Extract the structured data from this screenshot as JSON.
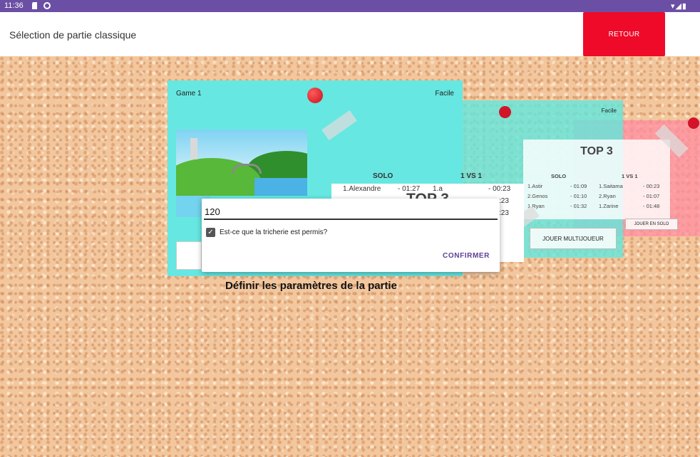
{
  "status_bar": {
    "time": "11:36"
  },
  "app_bar": {
    "title": "Sélection de partie classique",
    "back_button": "RETOUR"
  },
  "card_secondary": {
    "difficulty": "Facile",
    "top3_title": "TOP 3",
    "solo_header": "SOLO",
    "vs_header": "1 VS 1",
    "solo": [
      {
        "name": "1.Astir",
        "time": "- 01:09"
      },
      {
        "name": "2.Genos",
        "time": "- 01:10"
      },
      {
        "name": "1.Ryan",
        "time": "- 01:32"
      }
    ],
    "vs": [
      {
        "name": "1.Saitama",
        "time": "- 00:23"
      },
      {
        "name": "2.Ryan",
        "time": "- 01:07"
      },
      {
        "name": "1.Zarine",
        "time": "- 01:48"
      }
    ],
    "multi_button": "JOUER MULTIJOUEUR",
    "solo_button": "JOUER EN SOLO"
  },
  "card_main": {
    "game_name": "Game 1",
    "difficulty": "Facile",
    "top3_title": "TOP 3",
    "solo_header": "SOLO",
    "vs_header": "1 VS 1",
    "row1": {
      "solo_name": "1.Alexandre",
      "solo_time": "- 01:27",
      "vs_name": "1.a",
      "vs_time": "- 00:23"
    },
    "vs_partial_2": ":23",
    "vs_partial_3": ":23"
  },
  "dialog": {
    "input_value": "120",
    "checkbox_label": "Est-ce que la tricherie est permis?",
    "checkbox_checked": true,
    "confirm_button": "CONFIRMER"
  },
  "params_title": "Définir les paramètres de la partie",
  "colors": {
    "status_bar": "#6b4fa4",
    "back_button": "#ee0a28",
    "card": "#67e7e1",
    "accent": "#5b3f98"
  }
}
